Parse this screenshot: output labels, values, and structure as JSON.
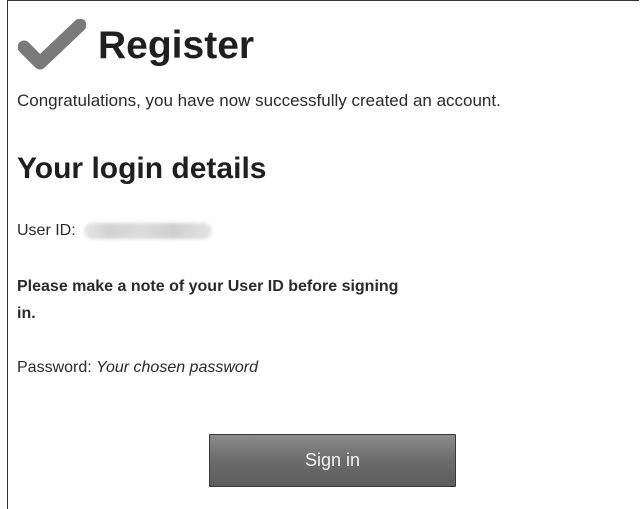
{
  "header": {
    "title": "Register",
    "icon": "checkmark-icon"
  },
  "message": {
    "success": "Congratulations, you have now successfully created an account."
  },
  "login_details": {
    "heading": "Your login details",
    "user_id_label": "User ID:",
    "note": "Please make a note of your User ID before signing in.",
    "password_label": "Password:",
    "password_value": "Your chosen password"
  },
  "actions": {
    "sign_in_label": "Sign in"
  },
  "colors": {
    "button_top": "#8c8c8c",
    "button_bottom": "#5c5c5c",
    "icon": "#7a7a7a",
    "text": "#1f1f1f"
  }
}
